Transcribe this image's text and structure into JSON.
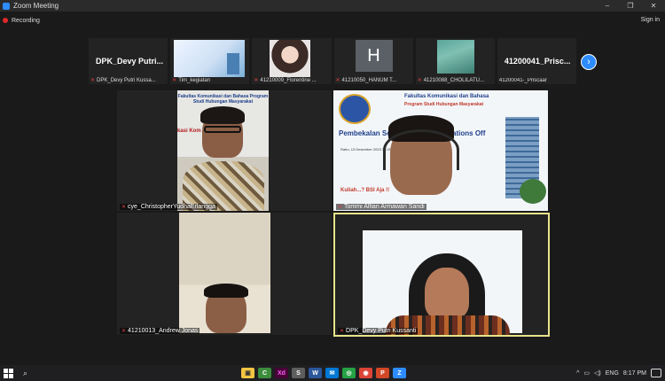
{
  "window": {
    "title": "Zoom Meeting",
    "controls": [
      "–",
      "❐",
      "✕"
    ]
  },
  "toolbar": {
    "recording_label": "Recording",
    "signin_label": "Sign in"
  },
  "participant_strip": [
    {
      "big_name": "DPK_Devy Putri...",
      "label": "DPK_Devy Putri Kussa..."
    },
    {
      "big_name": "",
      "label": "Tim_kegiatan"
    },
    {
      "big_name": "",
      "label": "41210009_Florentine ..."
    },
    {
      "big_name": "",
      "label": "41210050_HANUM T...",
      "avatar_letter": "H"
    },
    {
      "big_name": "",
      "label": "41210088_CHOLILATU..."
    },
    {
      "big_name": "41200041_Prisc...",
      "label": "41200041-_Priscaar"
    }
  ],
  "main_tiles": [
    {
      "name": "cye_ChristopherYudhaErlangga"
    },
    {
      "name": "Tommi Alfian Armawan Sandi",
      "poster": {
        "head": "Fakultas Komunikasi dan Bahasa",
        "sub": "Program Studi Hubungan Masyarakat",
        "title": "Pembekalan Sertifikasi Public Relations Off",
        "info": "Rabu, 13 Desember 2023 13.00 - 15.00 WIB",
        "bsi": "Kuliah...? BSI Aja !!"
      }
    },
    {
      "name": "41210013_Andrew Jonas"
    },
    {
      "name": "DPK_Devy Putri Kussanti",
      "active": true
    },
    {
      "poster_v1": {
        "line": "Fakultas Komunikasi dan Bahasa Program Studi Hubungan Masyarakat",
        "red": "kasi Kom ficer"
      }
    }
  ],
  "taskbar": {
    "lang": "ENG",
    "time": "8:17 PM",
    "apps": [
      "▣",
      "C",
      "Xd",
      "S",
      "W",
      "✉",
      "◎",
      "◉",
      "P",
      "Z"
    ]
  },
  "colors": {
    "accent": "#2d8cff",
    "recording": "#e02828",
    "active_speaker": "#e8e48a"
  }
}
